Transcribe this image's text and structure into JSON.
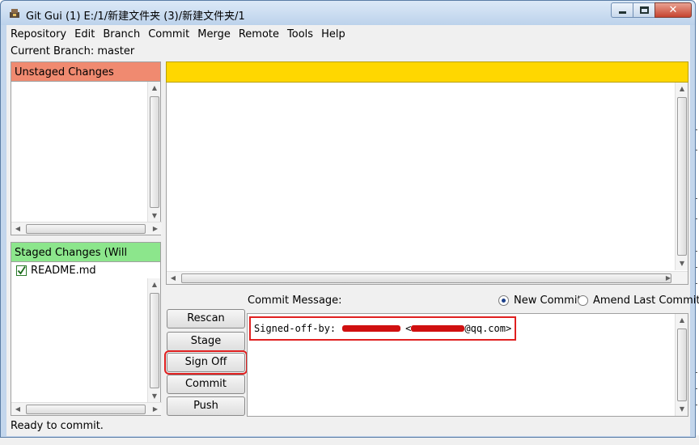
{
  "window": {
    "title": "Git Gui (1) E:/1/新建文件夹 (3)/新建文件夹/1",
    "buttons": {
      "minimize": "minimize-icon",
      "maximize": "maximize-icon",
      "close": "close-icon"
    }
  },
  "menu": [
    "Repository",
    "Edit",
    "Branch",
    "Commit",
    "Merge",
    "Remote",
    "Tools",
    "Help"
  ],
  "branch_label": "Current Branch: master",
  "unstaged": {
    "header": "Unstaged Changes",
    "files": []
  },
  "staged": {
    "header": "Staged Changes (Will Commit)",
    "files": [
      {
        "name": "README.md",
        "icon": "check-icon"
      }
    ]
  },
  "diff": {
    "header_color": "#ffd700"
  },
  "commit": {
    "label": "Commit Message:",
    "new_commit": "New Commit",
    "amend": "Amend Last Commit",
    "mode": "New Commit",
    "message_prefix": "Signed-off-by:",
    "message_suffix": "@qq.com>"
  },
  "buttons": {
    "rescan": "Rescan",
    "stage_changed": "Stage Changed",
    "sign_off": "Sign Off",
    "commit": "Commit",
    "push": "Push"
  },
  "status": "Ready to commit.",
  "colors": {
    "unstaged": "#f08a70",
    "staged": "#8ce68c",
    "highlight": "#e02020"
  }
}
